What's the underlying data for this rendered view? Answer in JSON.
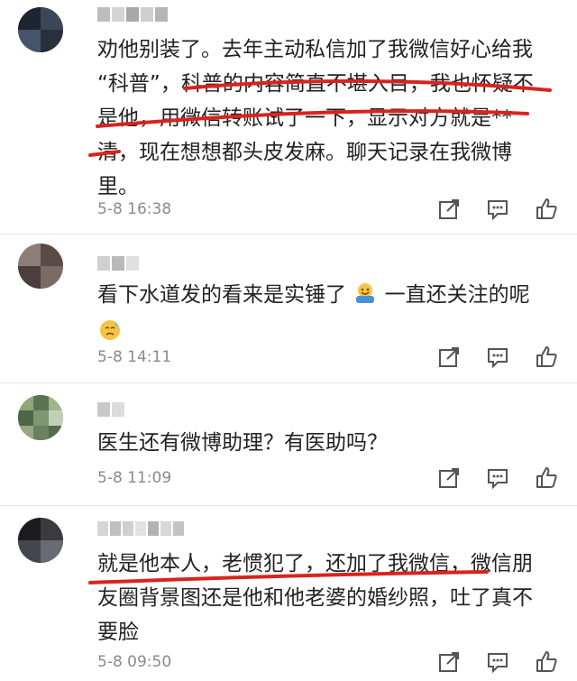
{
  "comments": [
    {
      "text_lines": [
        "劝他别装了。去年主动私信加了我微信好心给我",
        "“科普”，科普的内容简直不堪入目，我也怀疑不",
        "是他，用微信转账试了一下，显示对方就是**",
        "清，现在想想都头皮发麻。聊天记录在我微博",
        "里。"
      ],
      "time": "5-8 16:38"
    },
    {
      "text_before_emoji": "看下水道发的看来是实锤了",
      "text_after_emoji": "一直还关注的呢",
      "time": "5-8 14:11"
    },
    {
      "text_lines": [
        "医生还有微博助理？有医助吗？"
      ],
      "time": "5-8 11:09"
    },
    {
      "text_lines": [
        "就是他本人，老惯犯了，还加了我微信，微信朋",
        "友圈背景图还是他和他老婆的婚纱照，吐了真不",
        "要脸"
      ],
      "time": "5-8 09:50"
    }
  ],
  "icons": {
    "share": "share-icon",
    "reply": "comment-icon",
    "like": "thumbs-up-icon"
  },
  "colors": {
    "highlight_red": "#d9231e",
    "meta_gray": "#8a8a8a"
  }
}
